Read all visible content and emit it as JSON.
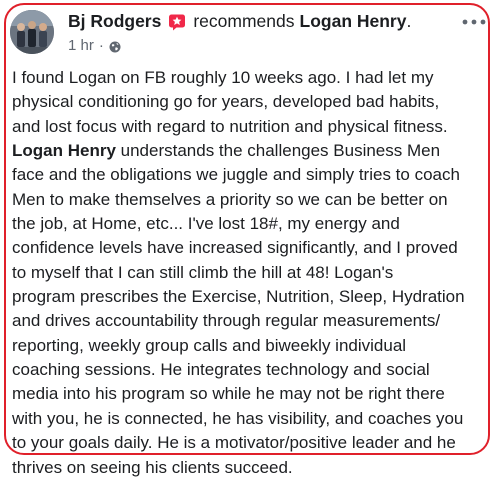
{
  "post": {
    "author": "Bj Rodgers",
    "action": "recommends",
    "page_name": "Logan Henry",
    "page_punct": ".",
    "timestamp": "1 hr",
    "separator": "·",
    "privacy_icon": "globe-icon",
    "recommend_icon": "recommend-flag-icon",
    "more_icon": "more-options-icon",
    "accent_color": "#f02849",
    "outline_color": "#e0202a",
    "body_lines": [
      [
        "I found Logan on FB roughly 10 weeks ago.  I had let my"
      ],
      [
        "physical conditioning go for years, developed bad habits,"
      ],
      [
        "and lost focus with regard to nutrition and physical fitness."
      ],
      [
        "",
        "Logan Henry",
        " understands the challenges Business Men"
      ],
      [
        "face and the obligations we juggle and simply tries to coach"
      ],
      [
        "Men to make themselves a priority so we can be better on"
      ],
      [
        "the job, at Home, etc...  I've lost 18#, my energy and"
      ],
      [
        "confidence levels have increased significantly, and I proved"
      ],
      [
        "to myself that I can still climb the hill at 48!  Logan's"
      ],
      [
        "program prescribes the Exercise, Nutrition, Sleep, Hydration"
      ],
      [
        "and drives accountability through regular measurements/"
      ],
      [
        "reporting, weekly group calls and biweekly individual"
      ],
      [
        "coaching sessions.  He integrates technology and social"
      ],
      [
        "media into his program so while he may not be right there"
      ],
      [
        "with you, he is connected, he has visibility, and coaches you"
      ],
      [
        "to your goals daily.  He is a motivator/positive leader and he"
      ],
      [
        "thrives on seeing his clients succeed."
      ]
    ]
  }
}
